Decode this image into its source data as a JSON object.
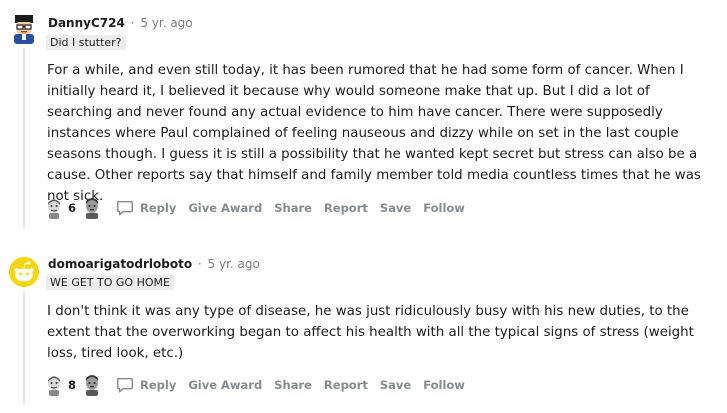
{
  "comments": [
    {
      "author": "DannyC724",
      "separator": "·",
      "time": "5 yr. ago",
      "flair": "Did I stutter?",
      "body": "For a while, and even still today, it has been rumored that he had some form of cancer. When I initially heard it, I believed it because why would someone make that up. But I did a lot of searching and never found any actual evidence to him have cancer. There were supposedly instances where Paul complained of feeling nauseous and dizzy while on set in the last couple seasons though. I guess it is still a possibility that he wanted kept secret but stress can also be a cause. Other reports say that himself and family member told media countless times that he was not sick.",
      "score": "6",
      "actions": {
        "reply": "Reply",
        "give_award": "Give Award",
        "share": "Share",
        "report": "Report",
        "save": "Save",
        "follow": "Follow"
      },
      "icons": {
        "avatar": "cartoon-avatar-icon",
        "upvote": "upvote-face-icon",
        "downvote": "downvote-face-icon",
        "reply": "speech-bubble-icon"
      }
    },
    {
      "author": "domoarigatodrloboto",
      "separator": "·",
      "time": "5 yr. ago",
      "flair": "WE GET TO GO HOME",
      "body": "I don't think it was any type of disease, he was just ridiculously busy with his new duties, to the extent that the overworking began to affect his health with all the typical signs of stress (weight loss, tired look, etc.)",
      "score": "8",
      "actions": {
        "reply": "Reply",
        "give_award": "Give Award",
        "share": "Share",
        "report": "Report",
        "save": "Save",
        "follow": "Follow"
      },
      "icons": {
        "avatar": "snoo-avatar-icon",
        "upvote": "upvote-face-icon",
        "downvote": "downvote-face-icon",
        "reply": "speech-bubble-icon"
      }
    }
  ],
  "colors": {
    "text": "#1c1c1c",
    "meta": "#7c7c7c",
    "action": "#878a8c",
    "flair_bg": "#ededed",
    "thread_line": "#e6e6e6",
    "snoo_yellow": "#f5d60a"
  }
}
